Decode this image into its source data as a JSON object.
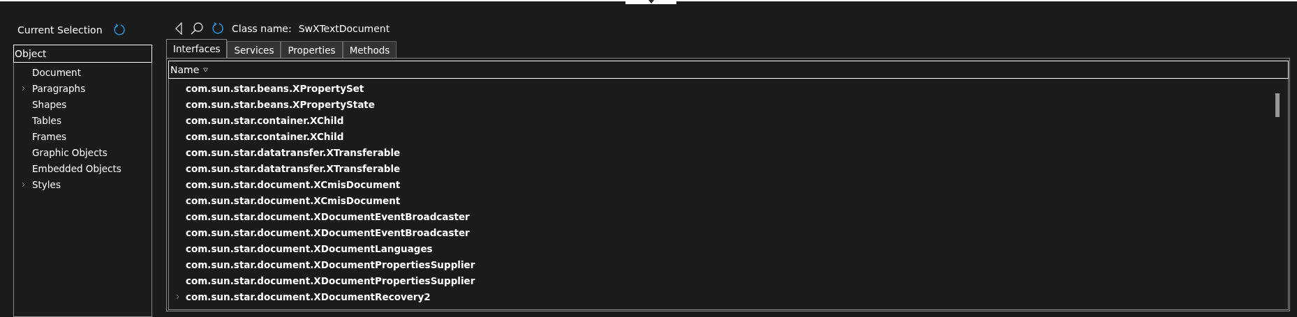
{
  "left_panel": {
    "title": "Current Selection",
    "object_field": {
      "value": "Object"
    },
    "tree": [
      {
        "label": "Document",
        "expandable": false
      },
      {
        "label": "Paragraphs",
        "expandable": true
      },
      {
        "label": "Shapes",
        "expandable": false
      },
      {
        "label": "Tables",
        "expandable": false
      },
      {
        "label": "Frames",
        "expandable": false
      },
      {
        "label": "Graphic Objects",
        "expandable": false
      },
      {
        "label": "Embedded Objects",
        "expandable": false
      },
      {
        "label": "Styles",
        "expandable": true
      }
    ]
  },
  "toolbar": {
    "class_label": "Class name:",
    "class_name": "SwXTextDocument"
  },
  "tabs": [
    {
      "label": "Interfaces",
      "selected": true
    },
    {
      "label": "Services",
      "selected": false
    },
    {
      "label": "Properties",
      "selected": false
    },
    {
      "label": "Methods",
      "selected": false
    }
  ],
  "table": {
    "columns": [
      {
        "label": "Name"
      }
    ],
    "rows": [
      {
        "name": "com.sun.star.beans.XPropertySet",
        "expandable": false
      },
      {
        "name": "com.sun.star.beans.XPropertyState",
        "expandable": false
      },
      {
        "name": "com.sun.star.container.XChild",
        "expandable": false
      },
      {
        "name": "com.sun.star.container.XChild",
        "expandable": false
      },
      {
        "name": "com.sun.star.datatransfer.XTransferable",
        "expandable": false
      },
      {
        "name": "com.sun.star.datatransfer.XTransferable",
        "expandable": false
      },
      {
        "name": "com.sun.star.document.XCmisDocument",
        "expandable": false
      },
      {
        "name": "com.sun.star.document.XCmisDocument",
        "expandable": false
      },
      {
        "name": "com.sun.star.document.XDocumentEventBroadcaster",
        "expandable": false
      },
      {
        "name": "com.sun.star.document.XDocumentEventBroadcaster",
        "expandable": false
      },
      {
        "name": "com.sun.star.document.XDocumentLanguages",
        "expandable": false
      },
      {
        "name": "com.sun.star.document.XDocumentPropertiesSupplier",
        "expandable": false
      },
      {
        "name": "com.sun.star.document.XDocumentPropertiesSupplier",
        "expandable": false
      },
      {
        "name": "com.sun.star.document.XDocumentRecovery2",
        "expandable": true
      }
    ]
  }
}
